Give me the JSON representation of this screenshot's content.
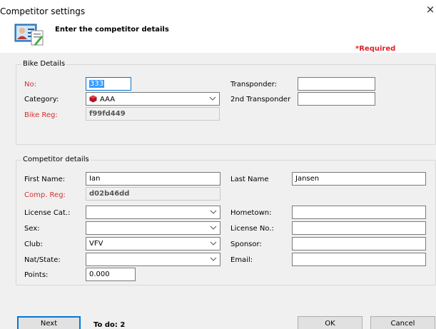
{
  "window": {
    "title": "Competitor settings",
    "close_glyph": "×"
  },
  "header": {
    "text": "Enter the competitor details",
    "required_note": "*Required",
    "icon": "user-form-icon"
  },
  "bike": {
    "group_title": "Bike Details",
    "no_label": "No:",
    "no_value": "333",
    "category_label": "Category:",
    "category_value": "AAA",
    "bike_reg_label": "Bike Reg:",
    "bike_reg_value": "f99fd449",
    "transponder_label": "Transponder:",
    "transponder_value": "",
    "transponder2_label": "2nd Transponder",
    "transponder2_value": ""
  },
  "competitor": {
    "group_title": "Competitor details",
    "first_name_label": "First Name:",
    "first_name_value": "Ian",
    "last_name_label": "Last Name",
    "last_name_value": "Jansen",
    "comp_reg_label": "Comp. Reg:",
    "comp_reg_value": "d02b46dd",
    "license_cat_label": "License Cat.:",
    "license_cat_value": "",
    "hometown_label": "Hometown:",
    "hometown_value": "",
    "sex_label": "Sex:",
    "sex_value": "",
    "license_no_label": "License No.:",
    "license_no_value": "",
    "club_label": "Club:",
    "club_value": "VFV",
    "sponsor_label": "Sponsor:",
    "sponsor_value": "",
    "nat_state_label": "Nat/State:",
    "nat_state_value": "",
    "email_label": "Email:",
    "email_value": "",
    "points_label": "Points:",
    "points_value": "0.000"
  },
  "footer": {
    "next_label": "Next",
    "todo_text": "To do: 2",
    "ok_label": "OK",
    "cancel_label": "Cancel"
  },
  "colors": {
    "required_red": "#e0202a",
    "focus_blue": "#0078d7",
    "label_red": "#d43030"
  }
}
